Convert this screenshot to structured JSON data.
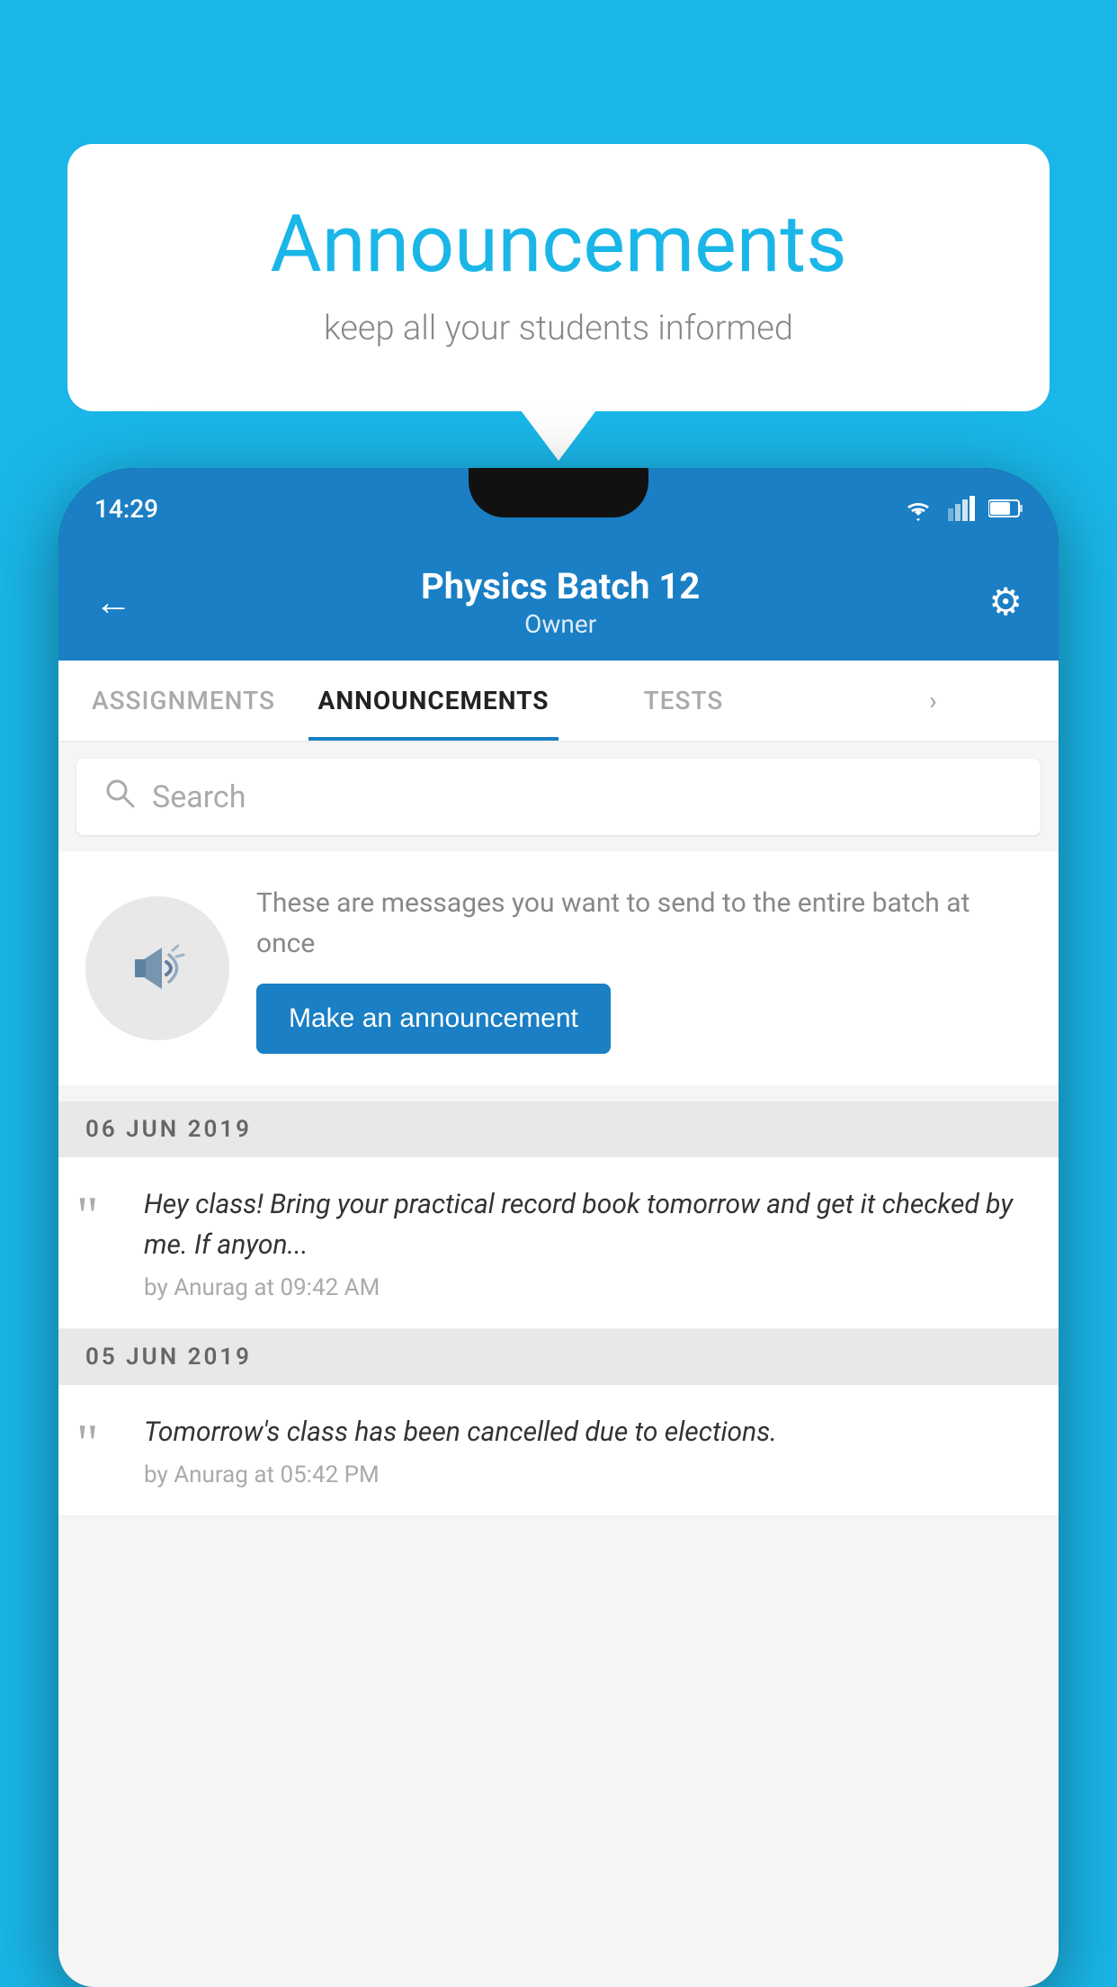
{
  "background_color": "#1ab6e8",
  "speech_bubble": {
    "title": "Announcements",
    "subtitle": "keep all your students informed"
  },
  "phone": {
    "status_bar": {
      "time": "14:29"
    },
    "header": {
      "title": "Physics Batch 12",
      "subtitle": "Owner",
      "back_label": "←",
      "gear_label": "⚙"
    },
    "tabs": [
      {
        "label": "ASSIGNMENTS",
        "active": false
      },
      {
        "label": "ANNOUNCEMENTS",
        "active": true
      },
      {
        "label": "TESTS",
        "active": false
      },
      {
        "label": "",
        "active": false
      }
    ],
    "search": {
      "placeholder": "Search"
    },
    "promo": {
      "description": "These are messages you want to send to the entire batch at once",
      "button_label": "Make an announcement"
    },
    "announcements": [
      {
        "date_header": "06  JUN  2019",
        "body": "Hey class! Bring your practical record book tomorrow and get it checked by me. If anyon...",
        "meta": "by Anurag at 09:42 AM"
      },
      {
        "date_header": "05  JUN  2019",
        "body": "Tomorrow's class has been cancelled due to elections.",
        "meta": "by Anurag at 05:42 PM"
      }
    ]
  }
}
